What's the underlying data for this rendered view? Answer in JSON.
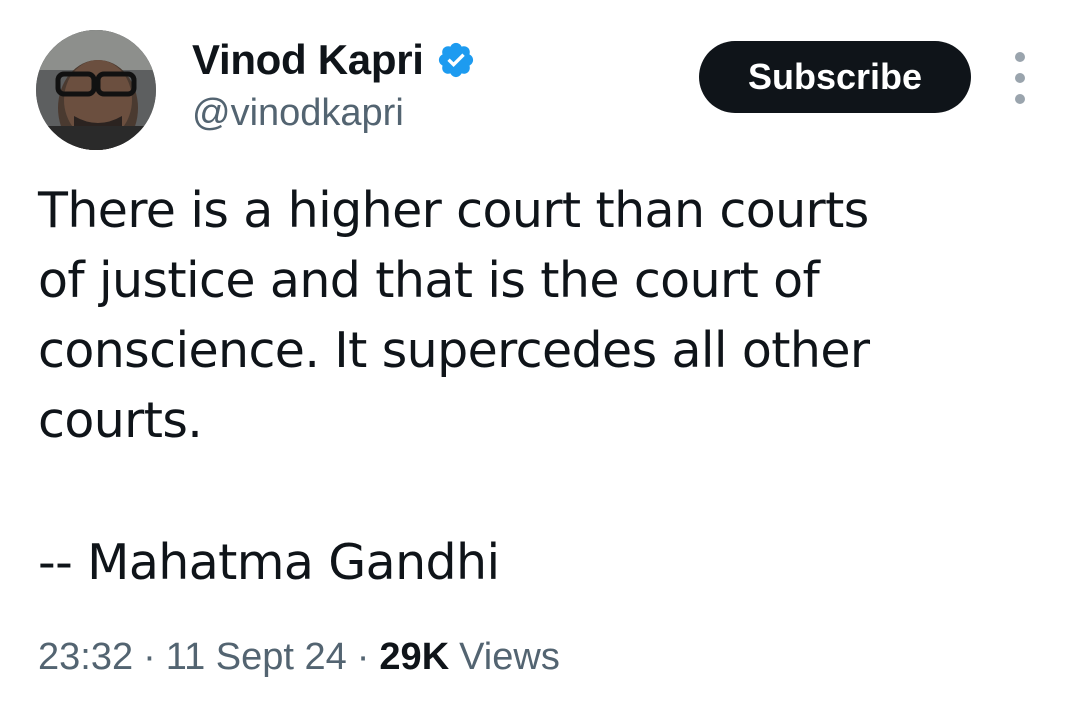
{
  "author": {
    "display_name": "Vinod Kapri",
    "handle": "@vinodkapri",
    "verified_icon": "verified-badge-icon",
    "avatar_icon": "avatar-photo"
  },
  "actions": {
    "subscribe_label": "Subscribe",
    "more_icon": "more-vertical-icon"
  },
  "tweet": {
    "text_lines": [
      "There is a higher court than courts",
      "of justice and that is the court of",
      "conscience. It supercedes all other",
      "courts."
    ],
    "attribution": "-- Mahatma Gandhi"
  },
  "meta": {
    "time": "23:32",
    "separator": "·",
    "date": "11 Sept 24",
    "views_count": "29K",
    "views_label": "Views"
  },
  "colors": {
    "verified": "#1d9bf0",
    "subscribe_bg": "#0f1419",
    "secondary_text": "#536471"
  }
}
